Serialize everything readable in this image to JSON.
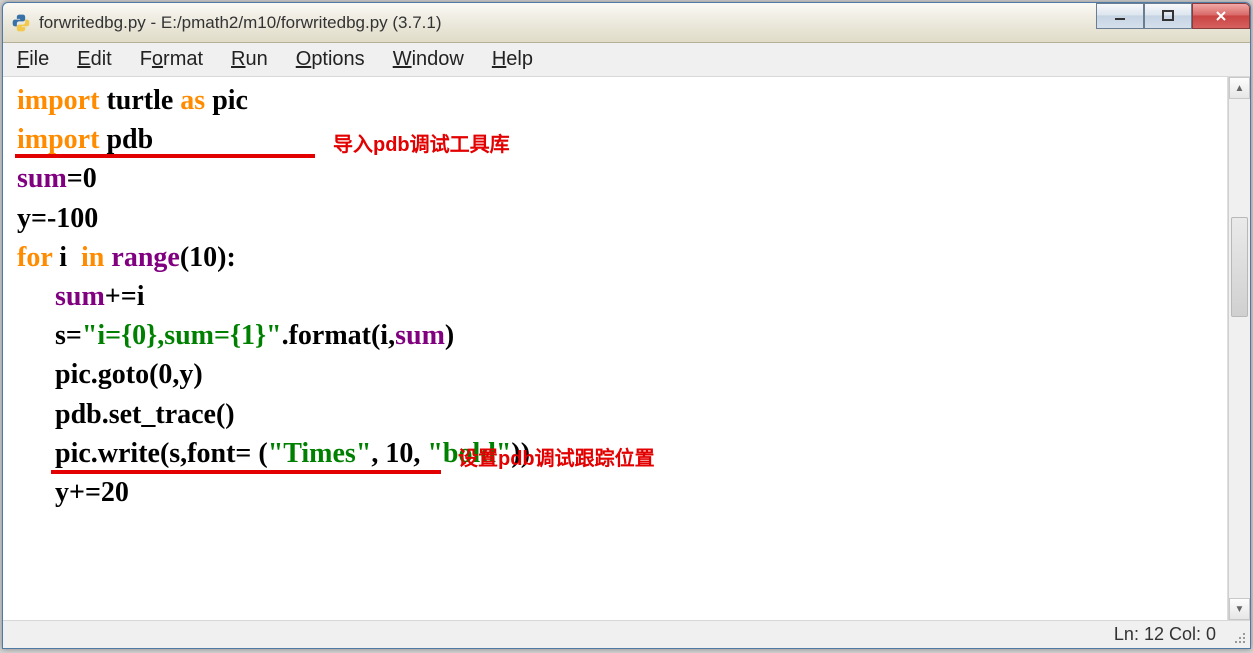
{
  "window": {
    "title": "forwritedbg.py - E:/pmath2/m10/forwritedbg.py (3.7.1)"
  },
  "menubar": {
    "file": "File",
    "edit": "Edit",
    "format": "Format",
    "run": "Run",
    "options": "Options",
    "window": "Window",
    "help": "Help"
  },
  "code": {
    "line1": {
      "kw_import": "import",
      "mod": " turtle ",
      "kw_as": "as",
      "alias": " pic"
    },
    "line2": {
      "kw_import": "import",
      "mod": " pdb"
    },
    "line3": {
      "var": "sum",
      "rest": "=0"
    },
    "line4": {
      "text": "y=-100"
    },
    "line5": {
      "kw_for": "for",
      "sp1": " i  ",
      "kw_in": "in",
      "sp2": " ",
      "func": "range",
      "args": "(10):"
    },
    "line6": {
      "var": "sum",
      "rest": "+=i"
    },
    "line7": {
      "pre": "s=",
      "str": "\"i={0},sum={1}\"",
      "mid": ".format(i,",
      "arg": "sum",
      "end": ")"
    },
    "line8": {
      "text": "pic.goto(0,y)"
    },
    "line9": {
      "text": "pdb.set_trace()"
    },
    "line10": {
      "pre": "pic.write(s,font= (",
      "s1": "\"Times\"",
      "mid": ", 10, ",
      "s2": "\"bold\"",
      "end": "))"
    },
    "line11": {
      "text": "y+=20"
    }
  },
  "annotations": {
    "a1": "导入pdb调试工具库",
    "a2": "设置pdb调试跟踪位置"
  },
  "status": {
    "text": "Ln: 12   Col: 0"
  }
}
